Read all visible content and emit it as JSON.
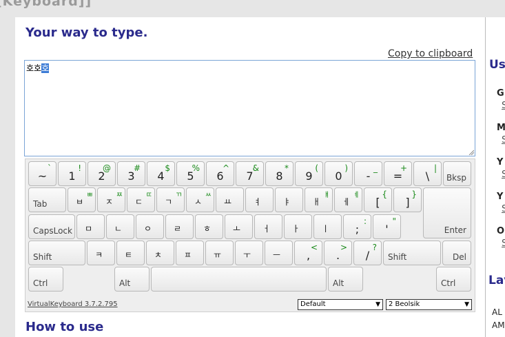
{
  "header": {
    "title": "[Keyboard]]"
  },
  "main": {
    "title": "Your way to type.",
    "copy_link": "Copy to clipboard",
    "text_before": "호호",
    "text_selected": "호",
    "how_to": "How to use"
  },
  "keyboard": {
    "version": "VirtualKeyboard 3.7.2.795",
    "skin_select": "Default",
    "layout_select": "2 Beolsik",
    "rows": [
      [
        {
          "m": "~",
          "s": "`"
        },
        {
          "m": "1",
          "s": "!"
        },
        {
          "m": "2",
          "s": "@"
        },
        {
          "m": "3",
          "s": "#"
        },
        {
          "m": "4",
          "s": "$"
        },
        {
          "m": "5",
          "s": "%"
        },
        {
          "m": "6",
          "s": "^"
        },
        {
          "m": "7",
          "s": "&"
        },
        {
          "m": "8",
          "s": "*"
        },
        {
          "m": "9",
          "s": "("
        },
        {
          "m": "0",
          "s": ")"
        },
        {
          "m": "-",
          "s": "_"
        },
        {
          "m": "=",
          "s": "+"
        },
        {
          "m": "\\",
          "s": "|"
        }
      ],
      [
        {
          "m": "ㅂ",
          "s": "ㅃ"
        },
        {
          "m": "ㅈ",
          "s": "ㅉ"
        },
        {
          "m": "ㄷ",
          "s": "ㄸ"
        },
        {
          "m": "ㄱ",
          "s": "ㄲ"
        },
        {
          "m": "ㅅ",
          "s": "ㅆ"
        },
        {
          "m": "ㅛ",
          "s": ""
        },
        {
          "m": "ㅕ",
          "s": ""
        },
        {
          "m": "ㅑ",
          "s": ""
        },
        {
          "m": "ㅐ",
          "s": "ㅒ"
        },
        {
          "m": "ㅔ",
          "s": "ㅖ"
        },
        {
          "m": "[",
          "s": "{"
        },
        {
          "m": "]",
          "s": "}"
        }
      ],
      [
        {
          "m": "ㅁ",
          "s": ""
        },
        {
          "m": "ㄴ",
          "s": ""
        },
        {
          "m": "ㅇ",
          "s": ""
        },
        {
          "m": "ㄹ",
          "s": ""
        },
        {
          "m": "ㅎ",
          "s": ""
        },
        {
          "m": "ㅗ",
          "s": ""
        },
        {
          "m": "ㅓ",
          "s": ""
        },
        {
          "m": "ㅏ",
          "s": ""
        },
        {
          "m": "ㅣ",
          "s": ""
        },
        {
          "m": ";",
          "s": ":"
        },
        {
          "m": "'",
          "s": "\""
        }
      ],
      [
        {
          "m": "ㅋ",
          "s": ""
        },
        {
          "m": "ㅌ",
          "s": ""
        },
        {
          "m": "ㅊ",
          "s": ""
        },
        {
          "m": "ㅍ",
          "s": ""
        },
        {
          "m": "ㅠ",
          "s": ""
        },
        {
          "m": "ㅜ",
          "s": ""
        },
        {
          "m": "ㅡ",
          "s": ""
        },
        {
          "m": ",",
          "s": "<"
        },
        {
          "m": ".",
          "s": ">"
        },
        {
          "m": "/",
          "s": "?"
        }
      ]
    ],
    "func": {
      "bksp": "Bksp",
      "tab": "Tab",
      "capslock": "CapsLock",
      "enter": "Enter",
      "shift_left": "Shift",
      "shift_right": "Shift",
      "del": "Del",
      "ctrl_left": "Ctrl",
      "alt_left": "Alt",
      "alt_right": "Alt",
      "ctrl_right": "Ctrl"
    }
  },
  "sidebar": {
    "heading": "Us",
    "items": [
      {
        "title": "G",
        "sub": "S"
      },
      {
        "title": "M",
        "sub": "S"
      },
      {
        "title": "Y",
        "sub": "S"
      },
      {
        "title": "Y",
        "sub": "S"
      },
      {
        "title": "O",
        "sub": "S"
      }
    ],
    "heading2": "Lav",
    "lines": [
      "AL",
      "AM"
    ]
  }
}
